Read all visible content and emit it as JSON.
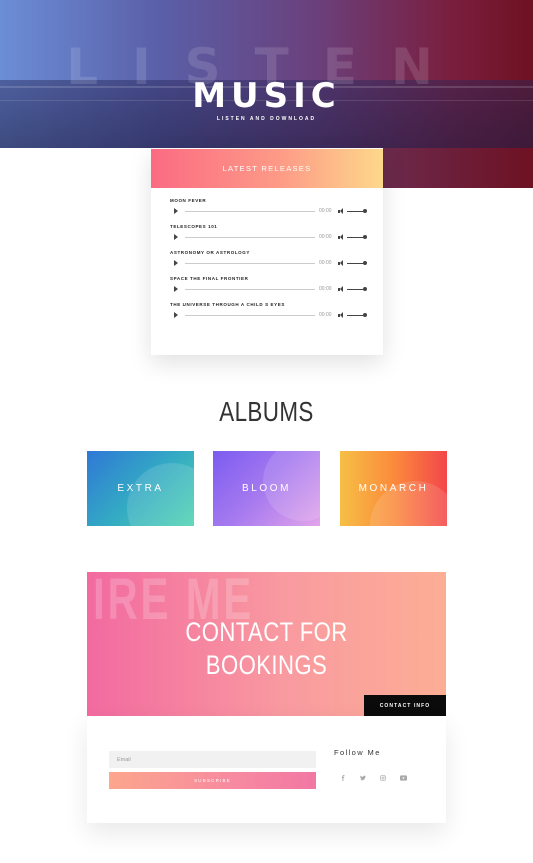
{
  "hero": {
    "ghost_text": "LISTEN",
    "title": "MUSIC",
    "subtitle": "LISTEN AND DOWNLOAD"
  },
  "playlist": {
    "heading": "LATEST RELEASES",
    "tracks": [
      {
        "title": "MOON FEVER",
        "time": "00:00"
      },
      {
        "title": "TELESCOPES 101",
        "time": "00:00"
      },
      {
        "title": "ASTRONOMY OR ASTROLOGY",
        "time": "00:00"
      },
      {
        "title": "SPACE THE FINAL FRONTIER",
        "time": "00:00"
      },
      {
        "title": "THE UNIVERSE THROUGH A CHILD S EYES",
        "time": "00:00"
      }
    ]
  },
  "albums": {
    "heading": "ALBUMS",
    "items": [
      {
        "label": "EXTRA"
      },
      {
        "label": "BLOOM"
      },
      {
        "label": "MONARCH"
      }
    ]
  },
  "contact": {
    "ghost_text": "IRE ME",
    "title_line1": "CONTACT FOR",
    "title_line2": "BOOKINGS",
    "button_label": "CONTACT INFO"
  },
  "form": {
    "email_placeholder": "Email",
    "subscribe_label": "SUBSCRIBE",
    "follow_label": "Follow Me",
    "social_icons": [
      "facebook-icon",
      "twitter-icon",
      "instagram-icon",
      "youtube-icon"
    ]
  },
  "colors": {
    "hero_start": "#6b8ed6",
    "hero_end": "#6e1123",
    "playlist_header_start": "#fb6b83",
    "playlist_header_end": "#fdd88a",
    "contact_start": "#f26aa0",
    "contact_end": "#fcae95",
    "contact_button": "#0b0b0b"
  }
}
